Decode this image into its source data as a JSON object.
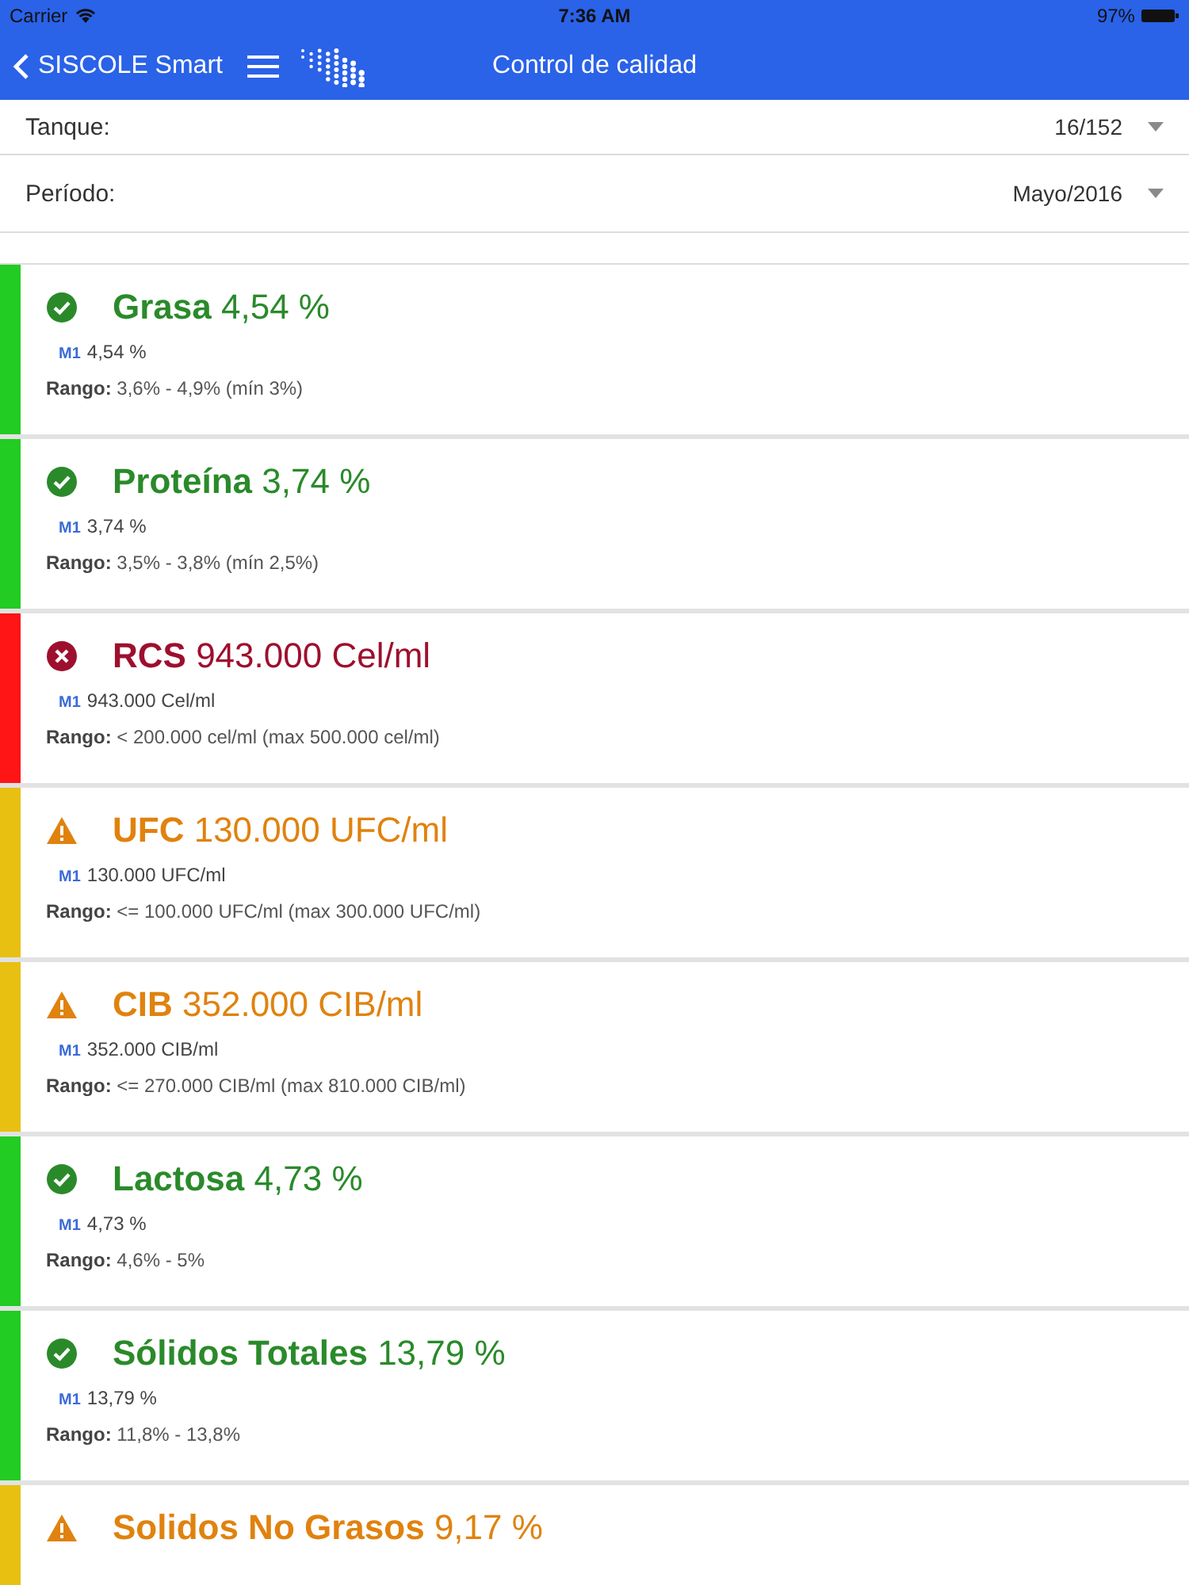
{
  "status_bar": {
    "carrier": "Carrier",
    "time": "7:36 AM",
    "battery": "97%"
  },
  "nav_bar": {
    "back_label": "SISCOLE Smart",
    "title": "Control de calidad"
  },
  "filters": [
    {
      "label": "Tanque:",
      "value": "16/152"
    },
    {
      "label": "Período:",
      "value": "Mayo/2016"
    }
  ],
  "results": [
    {
      "kind": "ok",
      "name": "Grasa",
      "value": "4,54 %",
      "sample_tag": "M1",
      "sample_value": "4,54 %",
      "range": "**Rango:** 3,6% - 4,9% (mín 3%)"
    },
    {
      "kind": "ok",
      "name": "Proteína",
      "value": "3,74 %",
      "sample_tag": "M1",
      "sample_value": "3,74 %",
      "range": "**Rango:** 3,5% - 3,8% (mín 2,5%)"
    },
    {
      "kind": "error",
      "name": "RCS",
      "value": "943.000 Cel/ml",
      "sample_tag": "M1",
      "sample_value": "943.000 Cel/ml",
      "range": "**Rango:** < 200.000 cel/ml (max 500.000 cel/ml)"
    },
    {
      "kind": "warning",
      "name": "UFC",
      "value": "130.000 UFC/ml",
      "sample_tag": "M1",
      "sample_value": "130.000 UFC/ml",
      "range": "**Rango:** <= 100.000 UFC/ml (max 300.000 UFC/ml)"
    },
    {
      "kind": "warning",
      "name": "CIB",
      "value": "352.000 CIB/ml",
      "sample_tag": "M1",
      "sample_value": "352.000 CIB/ml",
      "range": "**Rango:** <= 270.000 CIB/ml (max 810.000 CIB/ml)"
    },
    {
      "kind": "ok",
      "name": "Lactosa",
      "value": "4,73 %",
      "sample_tag": "M1",
      "sample_value": "4,73 %",
      "range": "**Rango:** 4,6% - 5%"
    },
    {
      "kind": "ok",
      "name": "Sólidos Totales",
      "value": "13,79 %",
      "sample_tag": "M1",
      "sample_value": "13,79 %",
      "range": "**Rango:** 11,8% - 13,8%"
    },
    {
      "kind": "warning",
      "name": "Solidos No Grasos",
      "value": "9,17 %"
    }
  ]
}
